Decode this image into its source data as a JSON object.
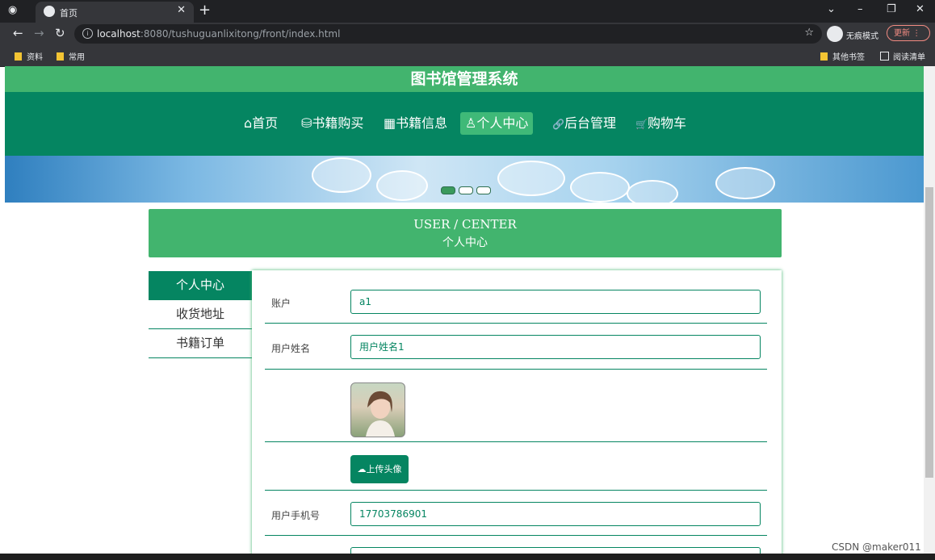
{
  "browser": {
    "tab_title": "首页",
    "url_host": "localhost",
    "url_rest": ":8080/tushuguanlixitong/front/index.html",
    "incognito_label": "无痕模式",
    "update_label": "更新",
    "bookmarks": [
      "资料",
      "常用"
    ],
    "bookmarks_right": [
      "其他书签",
      "阅读清单"
    ]
  },
  "site": {
    "title": "图书馆管理系统",
    "nav": [
      {
        "icon": "⌂",
        "label": "首页"
      },
      {
        "icon": "⛁",
        "label": "书籍购买"
      },
      {
        "icon": "▦",
        "label": "书籍信息"
      },
      {
        "icon": "♙",
        "label": "个人中心"
      },
      {
        "icon": "🔗",
        "label": "后台管理"
      },
      {
        "icon": "🛒",
        "label": "购物车"
      }
    ],
    "active_nav": 3
  },
  "header": {
    "en": "USER / CENTER",
    "zh": "个人中心"
  },
  "sidebar": [
    "个人中心",
    "收货地址",
    "书籍订单"
  ],
  "form": {
    "account_label": "账户",
    "account_value": "a1",
    "name_label": "用户姓名",
    "name_value": "用户姓名1",
    "upload_label": "上传头像",
    "phone_label": "用户手机号",
    "phone_value": "17703786901"
  },
  "watermark": "CSDN @maker011",
  "colors": {
    "primary": "#058561",
    "accent": "#42b46e"
  }
}
